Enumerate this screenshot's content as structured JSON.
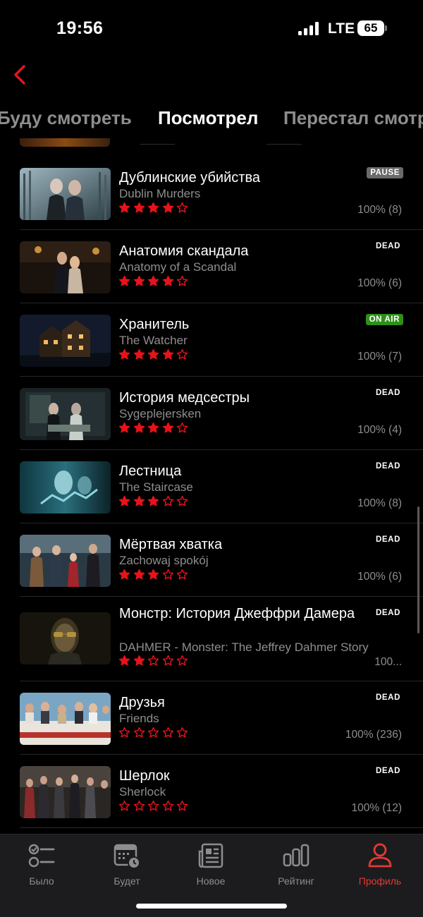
{
  "status_bar": {
    "time": "19:56",
    "network": "LTE",
    "battery": "65"
  },
  "tabs": [
    {
      "label": "Буду смотреть",
      "active": false
    },
    {
      "label": "Посмотрел",
      "active": true
    },
    {
      "label": "Перестал смотреть",
      "active": false
    }
  ],
  "shows": [
    {
      "title": "Дублинские убийства",
      "original": "Dublin Murders",
      "rating": 4,
      "status": "PAUSE",
      "progress": "100% (8)"
    },
    {
      "title": "Анатомия скандала",
      "original": "Anatomy of a Scandal",
      "rating": 4,
      "status": "DEAD",
      "progress": "100% (6)"
    },
    {
      "title": "Хранитель",
      "original": "The Watcher",
      "rating": 4,
      "status": "ON AIR",
      "progress": "100% (7)"
    },
    {
      "title": "История медсестры",
      "original": "Sygeplejersken",
      "rating": 4,
      "status": "DEAD",
      "progress": "100% (4)"
    },
    {
      "title": "Лестница",
      "original": "The Staircase",
      "rating": 3,
      "status": "DEAD",
      "progress": "100% (8)"
    },
    {
      "title": "Мёртвая хватка",
      "original": "Zachowaj spokój",
      "rating": 3,
      "status": "DEAD",
      "progress": "100% (6)"
    },
    {
      "title": "Монстр: История Джеффри Дамера",
      "original": "DAHMER - Monster: The Jeffrey Dahmer Story",
      "rating": 2,
      "status": "DEAD",
      "progress": "100..."
    },
    {
      "title": "Друзья",
      "original": "Friends",
      "rating": 0,
      "status": "DEAD",
      "progress": "100% (236)"
    },
    {
      "title": "Шерлок",
      "original": "Sherlock",
      "rating": 0,
      "status": "DEAD",
      "progress": "100% (12)"
    }
  ],
  "bottom_nav": [
    {
      "label": "Было",
      "icon": "checklist-icon",
      "active": false
    },
    {
      "label": "Будет",
      "icon": "calendar-clock-icon",
      "active": false
    },
    {
      "label": "Новое",
      "icon": "newspaper-icon",
      "active": false
    },
    {
      "label": "Рейтинг",
      "icon": "bar-chart-icon",
      "active": false
    },
    {
      "label": "Профиль",
      "icon": "person-icon",
      "active": true
    }
  ],
  "colors": {
    "accent": "#e53935",
    "star": "#e8121b",
    "on_air": "#2e8f1b",
    "pause": "#6a6a6a",
    "background": "#000000"
  }
}
